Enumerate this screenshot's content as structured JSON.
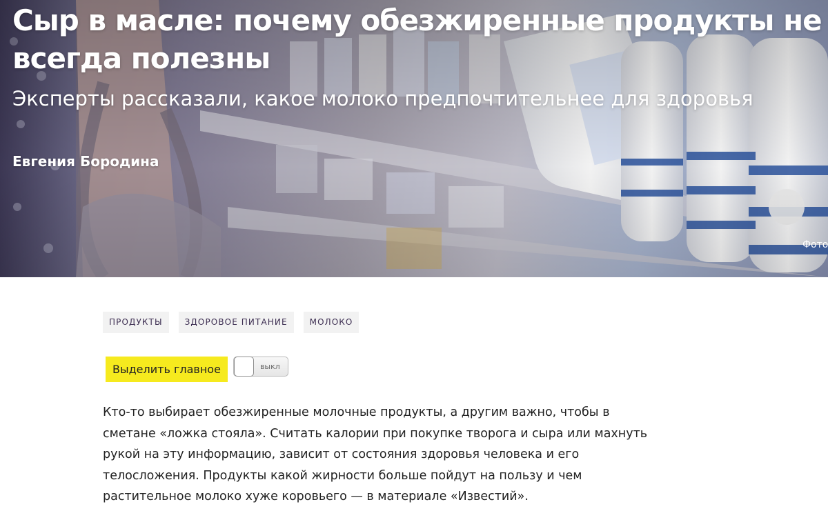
{
  "hero": {
    "title": "Сыр в масле: почему обезжиренные продукты не всегда полезны",
    "subtitle": "Эксперты рассказали, какое молоко предпочтительнее для здоровья",
    "author": "Евгения Бородина",
    "photo_credit": "Фото"
  },
  "tags": [
    {
      "label": "ПРОДУКТЫ"
    },
    {
      "label": "ЗДОРОВОЕ ПИТАНИЕ"
    },
    {
      "label": "МОЛОКО"
    }
  ],
  "highlight": {
    "label": "Выделить главное",
    "toggle_state_label": "выкл"
  },
  "lead": "Кто-то выбирает обезжиренные молочные продукты, а другим важно, чтобы в сметане «ложка стояла». Считать калории при покупке творога и сыра или махнуть рукой на эту информацию, зависит от состояния здоровья человека и его телосложения. Продукты какой жирности больше пойдут на пользу и чем растительное молоко хуже коровьего — в материале «Известий».",
  "colors": {
    "highlight_bg": "#f6ea1e",
    "tag_bg": "#f2f2f2",
    "tag_text": "#3d2e52",
    "body_text": "#222222"
  }
}
